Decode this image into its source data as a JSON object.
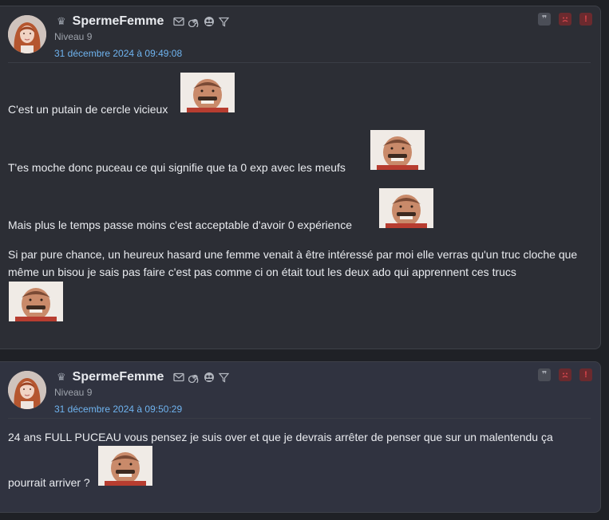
{
  "posts": [
    {
      "username": "SpermeFemme",
      "level": "Niveau 9",
      "date": "31 décembre 2024 à 09:49:08",
      "lines": [
        "C'est un putain de cercle vicieux",
        "T'es moche donc puceau ce qui signifie que ta 0 exp avec les meufs",
        "Mais plus le temps passe moins c'est acceptable d'avoir 0 expérience",
        "Si par pure chance, un heureux hasard une femme venait à être intéressé par moi elle verras qu'un truc cloche que même un bisou je sais pas faire c'est pas comme ci on était tout les deux ado qui apprennent ces trucs"
      ]
    },
    {
      "username": "SpermeFemme",
      "level": "Niveau 9",
      "date": "31 décembre 2024 à 09:50:29",
      "lines": [
        "24 ans FULL PUCEAU vous pensez je suis over et que je devrais arrêter de penser que sur un malentendu ça",
        "pourrait arriver ?"
      ]
    }
  ],
  "icons": {
    "crown": "crown-icon",
    "mail": "mail-icon",
    "spiral": "spiral-icon",
    "group": "group-icon",
    "filter": "filter-icon",
    "quote": "quote-icon",
    "sad": "sad-face-icon",
    "alert": "alert-icon",
    "sticker": "risitas-sticker"
  },
  "colors": {
    "background": "#1f2126",
    "post_bg": "#2c2e35",
    "date_link": "#6fb4f0",
    "alert_red": "#e0454c"
  }
}
